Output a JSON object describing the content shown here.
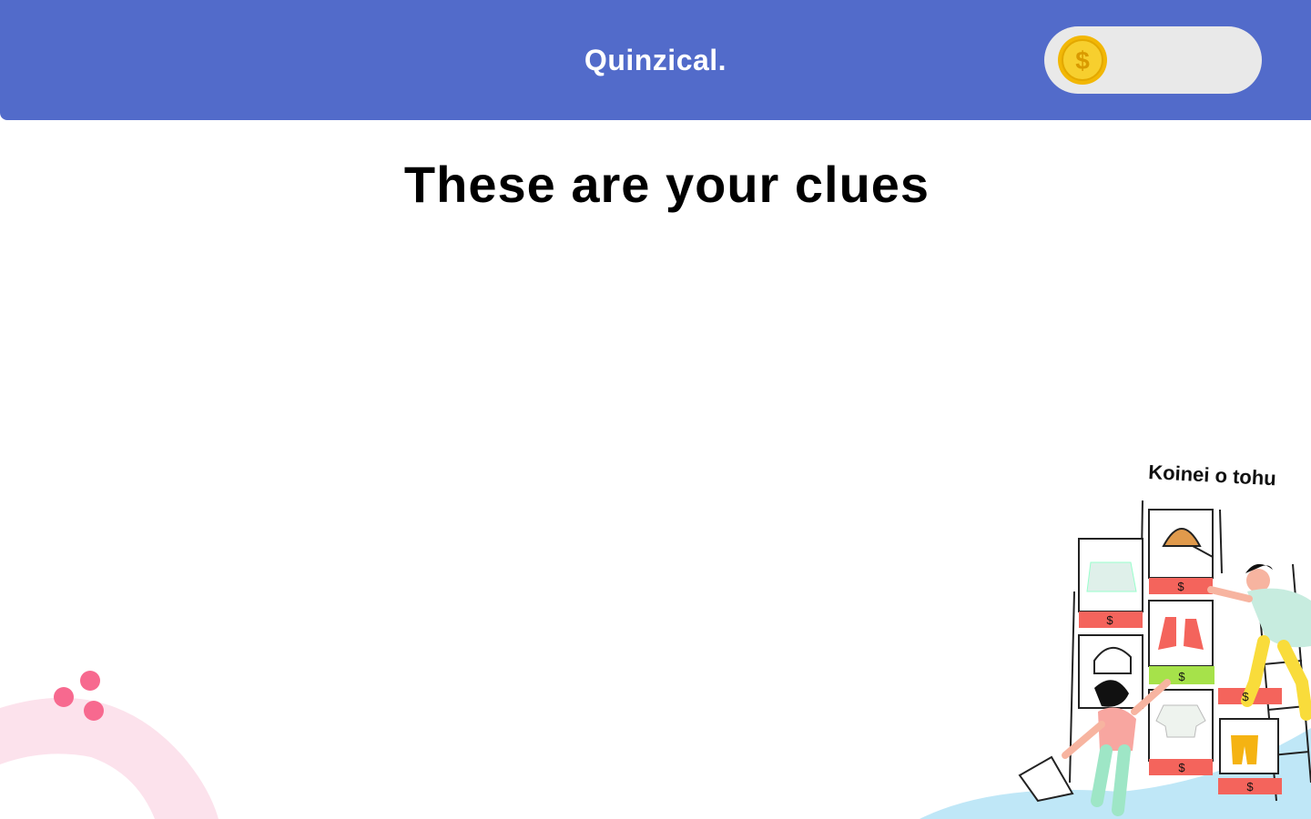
{
  "header": {
    "brand": "Quinzical.",
    "coins": {
      "icon": "dollar-coin-icon",
      "value": ""
    }
  },
  "main": {
    "title": "These are your clues"
  },
  "illustration": {
    "caption": "Koinei o tohu",
    "price_tag": "$"
  },
  "colors": {
    "header": "#526bca",
    "pill": "#e9e9e9",
    "coin": "#f5c518",
    "deco_pink": "#f7698f",
    "deco_arc": "#fce2ec",
    "wave": "#bfe7f7"
  }
}
